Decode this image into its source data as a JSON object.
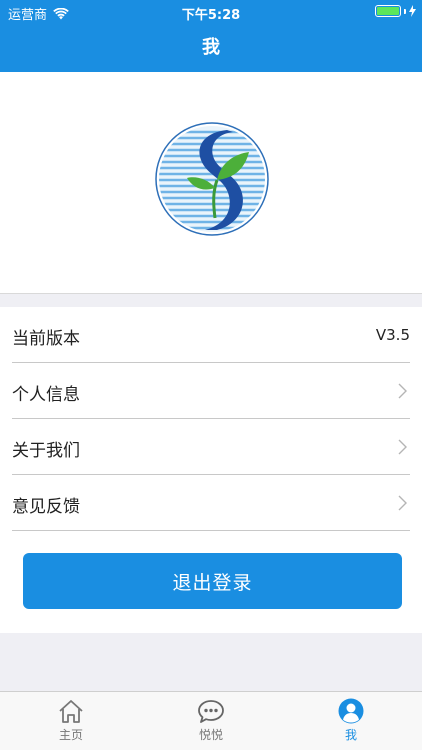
{
  "status_bar": {
    "carrier": "运营商",
    "time": "下午5:28",
    "battery_level": 1.0
  },
  "nav": {
    "title": "我"
  },
  "logo": {
    "icon": "sprout-s-logo-icon"
  },
  "menu": {
    "items": [
      {
        "label": "当前版本",
        "value": "V3.5",
        "icon": null
      },
      {
        "label": "个人信息",
        "value": null,
        "icon": "chevron-right-icon"
      },
      {
        "label": "关于我们",
        "value": null,
        "icon": "chevron-right-icon"
      },
      {
        "label": "意见反馈",
        "value": null,
        "icon": "chevron-right-icon"
      }
    ],
    "logout_label": "退出登录"
  },
  "tabbar": {
    "tabs": [
      {
        "label": "主页",
        "icon": "home-icon",
        "active": false
      },
      {
        "label": "悦悦",
        "icon": "chat-bubble-icon",
        "active": false
      },
      {
        "label": "我",
        "icon": "user-profile-icon",
        "active": true
      }
    ]
  },
  "colors": {
    "primary": "#1a8ee1",
    "background": "#efeff4",
    "tab_inactive": "#777777",
    "battery": "#5ce65c"
  }
}
